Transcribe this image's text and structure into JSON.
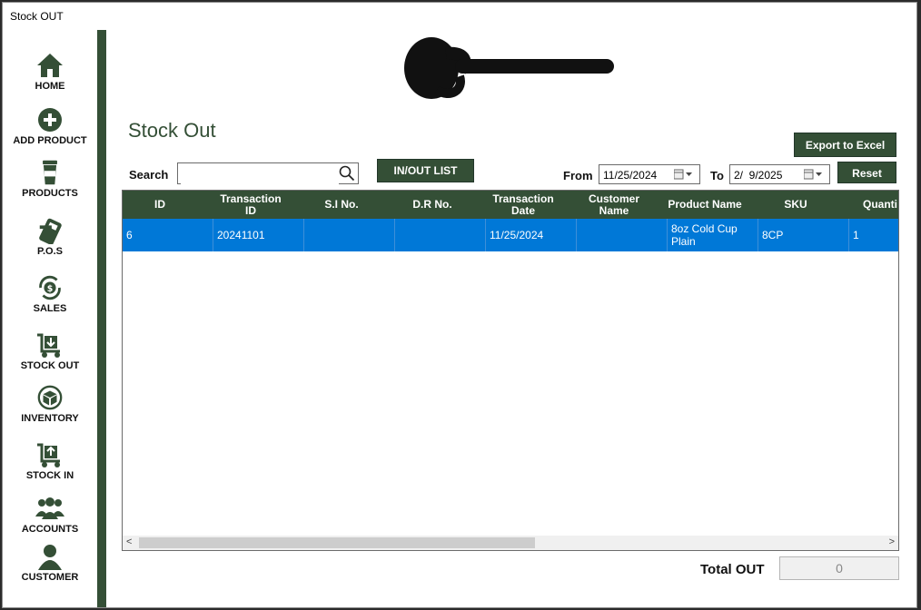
{
  "window": {
    "title": "Stock OUT"
  },
  "sidebar": {
    "items": [
      {
        "label": "HOME",
        "icon": "home-icon"
      },
      {
        "label": "ADD PRODUCT",
        "icon": "plus-circle-icon"
      },
      {
        "label": "PRODUCTS",
        "icon": "cup-icon"
      },
      {
        "label": "P.O.S",
        "icon": "card-terminal-icon"
      },
      {
        "label": "SALES",
        "icon": "dollar-cycle-icon"
      },
      {
        "label": "STOCK OUT",
        "icon": "cart-down-icon"
      },
      {
        "label": "INVENTORY",
        "icon": "box-cycle-icon"
      },
      {
        "label": "STOCK IN",
        "icon": "cart-up-icon"
      },
      {
        "label": "ACCOUNTS",
        "icon": "users-icon"
      },
      {
        "label": "CUSTOMER",
        "icon": "user-icon"
      }
    ]
  },
  "main": {
    "page_title": "Stock Out",
    "search": {
      "label": "Search",
      "value": "",
      "placeholder": ""
    },
    "inout_list_label": "IN/OUT LIST",
    "export_label": "Export to Excel",
    "from_label": "From",
    "from_date": "11/25/2024",
    "to_label": "To",
    "to_date": "2/  9/2025",
    "reset_label": "Reset",
    "table": {
      "columns": [
        "ID",
        "Transaction ID",
        "S.I No.",
        "D.R No.",
        "Transaction Date",
        "Customer Name",
        "Product Name",
        "SKU",
        "Quanti"
      ],
      "rows": [
        [
          "6",
          "20241101",
          "",
          "",
          "11/25/2024",
          "",
          "8oz Cold Cup Plain",
          "8CP",
          "1"
        ]
      ]
    },
    "total_label": "Total OUT",
    "total_value": "0"
  },
  "colors": {
    "brand_green": "#344f36",
    "selection_blue": "#0078d7"
  }
}
